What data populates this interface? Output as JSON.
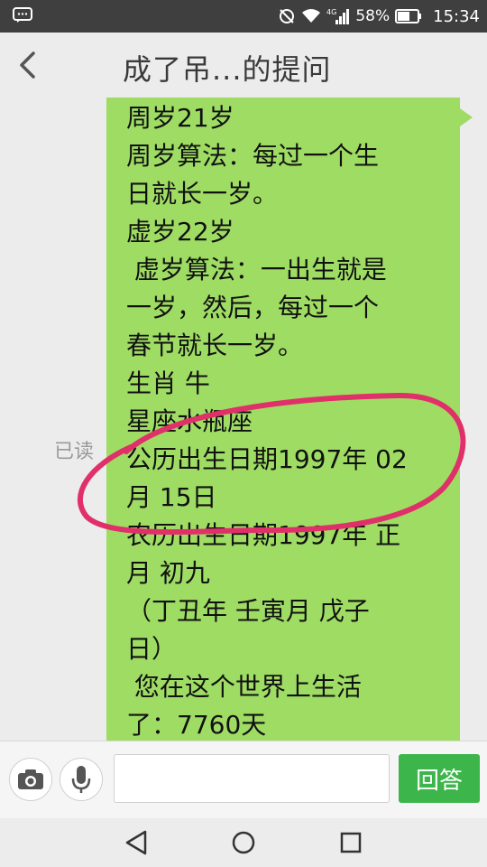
{
  "status_bar": {
    "battery": "58%",
    "time": "15:34",
    "icons": [
      "message-icon",
      "signal-icon",
      "wifi-icon",
      "battery-icon"
    ]
  },
  "header": {
    "title": "成了吊...的提问",
    "back_icon": "chevron-left-icon"
  },
  "chat": {
    "read_status": "已读",
    "message_lines": [
      "周岁21岁",
      "周岁算法：每过一个生",
      "日就长一岁。",
      "虚岁22岁",
      " 虚岁算法：一出生就是",
      "一岁，然后，每过一个",
      "春节就长一岁。",
      "生肖 牛",
      "星座水瓶座",
      "公历出生日期1997年 02",
      "月 15日",
      "农历出生日期1997年 正",
      "月 初九",
      "（丁丑年 壬寅月 戊子",
      "日）",
      " 您在这个世界上生活",
      "了：7760天"
    ],
    "bubble_color": "#9fdc64",
    "annotation_color": "#e0306a"
  },
  "input_bar": {
    "text_value": "",
    "answer_label": "回答",
    "answer_color": "#3cb54a",
    "icons": [
      "camera-icon",
      "microphone-icon"
    ]
  },
  "nav_bar": {
    "icons": [
      "nav-back-icon",
      "nav-home-icon",
      "nav-recent-icon"
    ]
  }
}
